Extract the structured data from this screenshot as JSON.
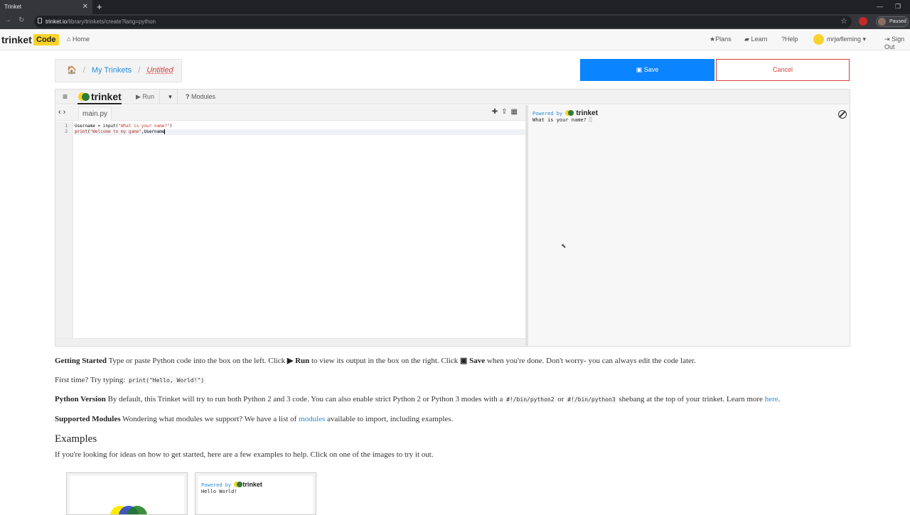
{
  "browser": {
    "tab_title": "Trinket",
    "tab_close": "✕",
    "new_tab": "+",
    "url_domain": "trinket.io",
    "url_path": "/library/trinkets/create?lang=python",
    "profile_status": "Paused",
    "win_min": "—",
    "win_max": "❐"
  },
  "site_header": {
    "logo": "trinket",
    "logo_badge": "Code",
    "home": "Home",
    "plans": "Plans",
    "learn": "Learn",
    "help": "Help",
    "username": "mrjwfleming",
    "signout": "Sign Out"
  },
  "breadcrumb": {
    "home_icon": "🏠",
    "my_trinkets": "My Trinkets",
    "current": "Untitled",
    "separator": "/"
  },
  "actions": {
    "save": "Save",
    "cancel": "Cancel"
  },
  "widget": {
    "logo": "trinket",
    "run": "Run",
    "modules": "Modules",
    "file_tab": "main.py",
    "line_numbers": [
      "1",
      "2"
    ],
    "code_lines": [
      {
        "pre": "Username = input(",
        "str": "\"What is your name?\"",
        "post": ")"
      },
      {
        "kw": "print",
        "pre": "(",
        "str": "\"Welcome to my game\"",
        "post": ",Username"
      }
    ],
    "output_powered": "Powered by",
    "output_logo": "trinket",
    "output_text": "What is your name?"
  },
  "help_text": {
    "getting_started_label": "Getting Started",
    "getting_started_1": "Type or paste Python code into the box on the left. Click",
    "run_word": "Run",
    "getting_started_2": "to view its output in the box on the right. Click",
    "save_word": "Save",
    "getting_started_3": "when you're done. Don't worry- you can always edit the code later.",
    "first_time": "First time? Try typing:",
    "first_time_code": "print(\"Hello, World!\")",
    "python_version_label": "Python Version",
    "python_version_1": "By default, this Trinket will try to run both Python 2 and 3 code. You can also enable strict Python 2 or Python 3 modes with a",
    "py2": "#!/bin/python2",
    "or": "or",
    "py3": "#!/bin/python3",
    "python_version_2": "shebang at the top of your trinket. Learn more",
    "here": "here",
    "modules_label": "Supported Modules",
    "modules_1": "Wondering what modules we support? We have a list of",
    "modules_link": "modules",
    "modules_2": "available to import, including examples."
  },
  "examples": {
    "heading": "Examples",
    "intro": "If you're looking for ideas on how to get started, here are a few examples to help. Click on one of the images to try it out.",
    "card2_powered": "Powered by",
    "card2_logo": "trinket",
    "card2_output": "Hello World!"
  },
  "colors": {
    "save_blue": "#0b84ff",
    "cancel_red": "#d43f3a",
    "link_blue": "#2a8bd6",
    "brand_yellow": "#f8d32a"
  }
}
